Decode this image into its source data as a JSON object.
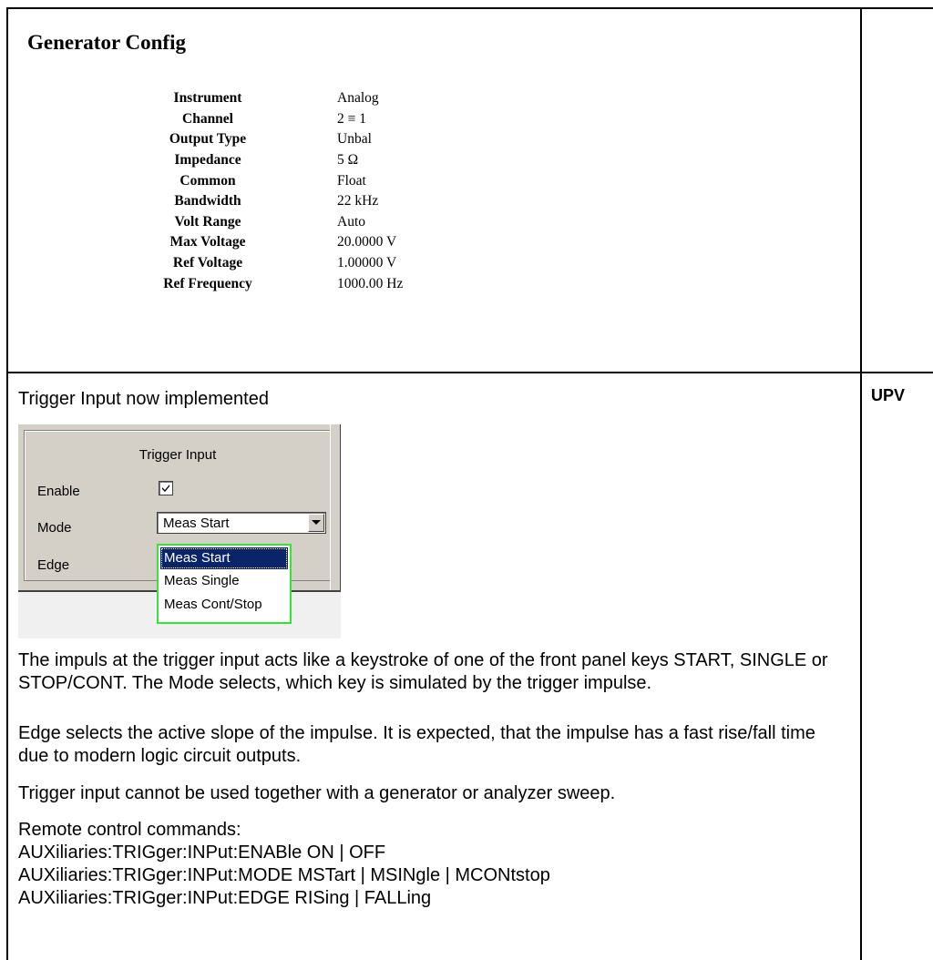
{
  "generator_config": {
    "title": "Generator Config",
    "rows": [
      {
        "label": "Instrument",
        "value": "Analog"
      },
      {
        "label": "Channel",
        "value": "2 ≡ 1"
      },
      {
        "label": "Output Type",
        "value": "Unbal"
      },
      {
        "label": "Impedance",
        "value": "5 Ω"
      },
      {
        "label": "Common",
        "value": "Float"
      },
      {
        "label": "Bandwidth",
        "value": "22 kHz"
      },
      {
        "label": "Volt Range",
        "value": "Auto"
      },
      {
        "label": "Max Voltage",
        "value": "20.0000 V"
      },
      {
        "label": "Ref Voltage",
        "value": "1.00000 V"
      },
      {
        "label": "Ref Frequency",
        "value": "1000.00 Hz"
      }
    ]
  },
  "side_tag": "UPV",
  "trigger": {
    "heading": "Trigger Input now implemented",
    "dialog": {
      "title": "Trigger Input",
      "enable_label": "Enable",
      "enable_checked": true,
      "mode_label": "Mode",
      "mode_value": "Meas Start",
      "edge_label": "Edge",
      "options": [
        "Meas Start",
        "Meas Single",
        "Meas Cont/Stop"
      ],
      "selected_index": 0,
      "highlight_color": "#39e139",
      "selection_color": "#0a246a"
    },
    "paragraphs": [
      "The impuls at the trigger input acts like a keystroke of one of the front panel keys START, SINGLE or STOP/CONT. The Mode selects, which key is simulated by the trigger impulse.",
      "Edge selects the active slope of the impulse. It is expected, that the impulse has a fast rise/fall time due to modern logic circuit outputs.",
      "Trigger input cannot be used together with a generator or analyzer sweep."
    ],
    "remote": {
      "heading": "Remote control commands:",
      "commands": [
        "AUXiliaries:TRIGger:INPut:ENABle ON | OFF",
        "AUXiliaries:TRIGger:INPut:MODE MSTart | MSINgle | MCONtstop",
        "AUXiliaries:TRIGger:INPut:EDGE RISing | FALLing"
      ]
    }
  }
}
